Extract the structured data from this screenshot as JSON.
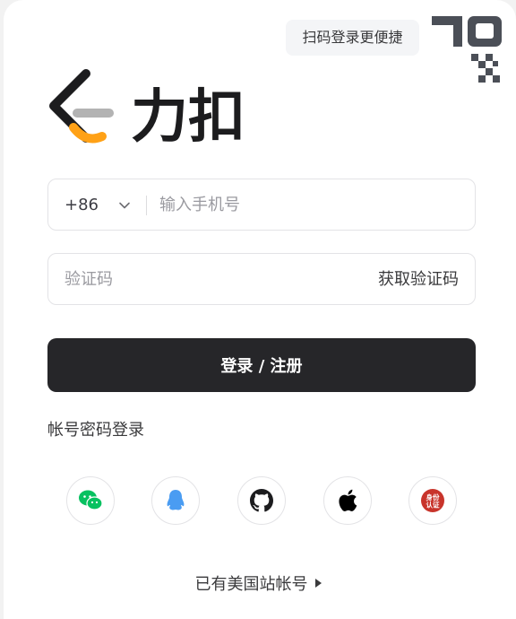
{
  "header": {
    "qr_tip": "扫码登录更便捷",
    "logo_text": "力扣"
  },
  "phone": {
    "country_code": "+86",
    "placeholder": "输入手机号"
  },
  "code": {
    "placeholder": "验证码",
    "get_code_label": "获取验证码"
  },
  "actions": {
    "submit_label": "登录 / 注册",
    "password_login_label": "帐号密码登录",
    "us_site_label": "已有美国站帐号"
  },
  "social": {
    "items": [
      "wechat-icon",
      "qq-icon",
      "github-icon",
      "apple-icon",
      "identity-auth-icon"
    ],
    "identity_auth_text": "身份认证"
  },
  "colors": {
    "primary_dark": "#262629",
    "logo_orange": "#ffa116",
    "wechat_green": "#07c160",
    "qq_blue": "#4a9cf2",
    "id_red": "#c8342b"
  }
}
